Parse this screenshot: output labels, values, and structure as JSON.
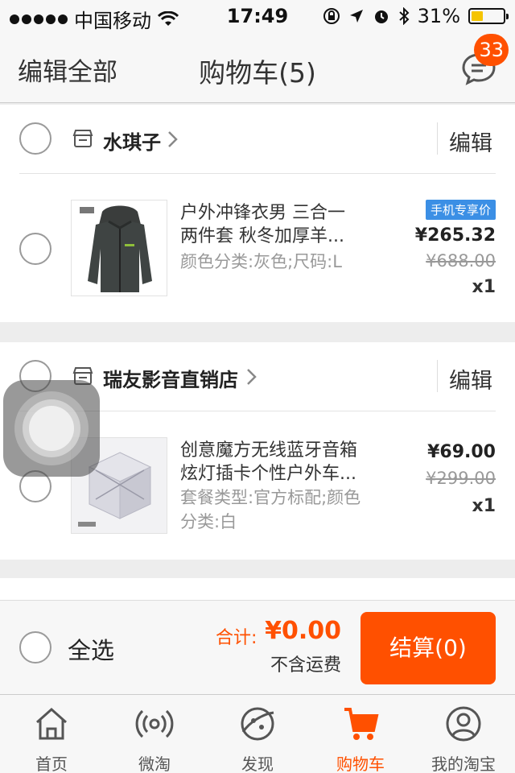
{
  "status_bar": {
    "carrier": "中国移动",
    "time": "17:49",
    "battery": "31%",
    "battery_level": 0.31
  },
  "header": {
    "edit_all": "编辑全部",
    "title": "购物车(5)",
    "message_badge": "33"
  },
  "stores": [
    {
      "name": "水琪子",
      "edit": "编辑",
      "item": {
        "title_line1": "户外冲锋衣男 三合一",
        "title_line2": "两件套 秋冬加厚羊...",
        "spec": "颜色分类:灰色;尺码:L",
        "tag": "手机专享价",
        "price": "¥265.32",
        "original_price": "¥688.00",
        "quantity": "x1"
      }
    },
    {
      "name": "瑞友影音直销店",
      "edit": "编辑",
      "item": {
        "title_line1": "创意魔方无线蓝牙音箱",
        "title_line2": "炫灯插卡个性户外车...",
        "spec": "套餐类型:官方标配;颜色分类:白",
        "price": "¥69.00",
        "original_price": "¥299.00",
        "quantity": "x1"
      }
    }
  ],
  "checkout": {
    "select_all": "全选",
    "total_label": "合计:",
    "total_value": "¥0.00",
    "shipping_note": "不含运费",
    "button": "结算(0)"
  },
  "tabs": [
    {
      "label": "首页",
      "icon": "home-icon"
    },
    {
      "label": "微淘",
      "icon": "broadcast-icon"
    },
    {
      "label": "发现",
      "icon": "discover-icon"
    },
    {
      "label": "购物车",
      "icon": "cart-icon",
      "active": true
    },
    {
      "label": "我的淘宝",
      "icon": "profile-icon"
    }
  ],
  "colors": {
    "accent": "#ff5000",
    "tag_blue": "#3b8fe5"
  }
}
